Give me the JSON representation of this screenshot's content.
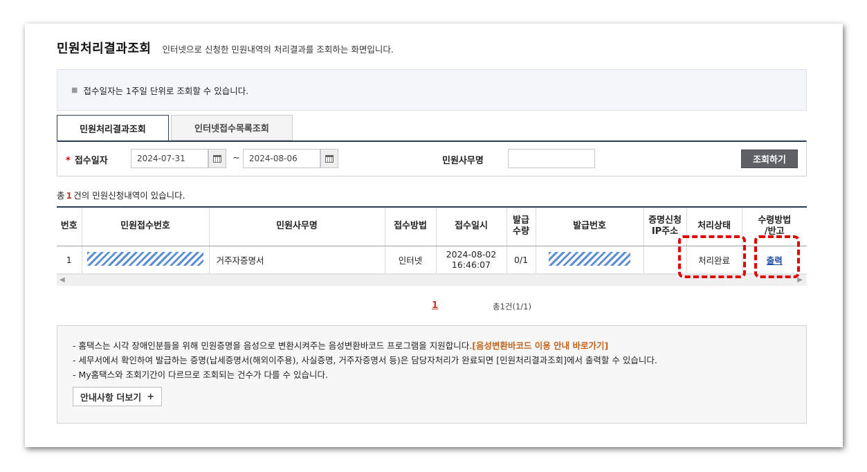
{
  "header": {
    "title": "민원처리결과조회",
    "description": "인터넷으로 신청한 민원내역의 처리결과를 조회하는 화면입니다."
  },
  "notice": {
    "text": "접수일자는 1주일 단위로 조회할 수 있습니다."
  },
  "tabs": [
    {
      "label": "민원처리결과조회",
      "active": true
    },
    {
      "label": "인터넷접수목록조회",
      "active": false
    }
  ],
  "search": {
    "date_label": "접수일자",
    "required_mark": "*",
    "start_date": "2024-07-31",
    "separator": "~",
    "end_date": "2024-08-06",
    "office_label": "민원사무명",
    "office_value": "",
    "button_label": "조회하기"
  },
  "result_count": {
    "prefix": "총",
    "count": "1",
    "suffix": "건의 민원신청내역이 있습니다."
  },
  "table": {
    "headers": [
      "번호",
      "민원접수번호",
      "민원사무명",
      "접수방법",
      "접수일시",
      "발급\n수량",
      "발급번호",
      "증명신청\nIP주소",
      "처리상태",
      "수령방법\n/반고"
    ],
    "rows": [
      {
        "no": "1",
        "receipt_no": "",
        "office_name": "거주자증명서",
        "method": "인터넷",
        "datetime_date": "2024-08-02",
        "datetime_time": "16:46:07",
        "issue_qty": "0/1",
        "issue_no": "",
        "ip": "",
        "status": "처리완료",
        "receive": "출력"
      }
    ]
  },
  "pager": {
    "current": "1",
    "total_text": "총1건(1/1)"
  },
  "info": {
    "lines": [
      {
        "text": "- 홈택스는 시각 장애인분들을 위해 민원증명을 음성으로 변환시켜주는 음성변환바코드 프로그램을 지원합니다.",
        "highlight": "[음성변환바코드 이용 안내 바로가기]"
      },
      {
        "text": "- 세무서에서 확인하여 발급하는 증명(납세증명서(해외이주용), 사실증명, 거주자증명서 등)은 담당자처리가 완료되면 [민원처리결과조회]에서 출력할 수 있습니다.",
        "highlight": ""
      },
      {
        "text": "- My홈택스와 조회기간이 다르므로 조회되는 건수가 다를 수 있습니다.",
        "highlight": ""
      }
    ],
    "more_label": "안내사항 더보기",
    "more_icon": "+"
  },
  "colors": {
    "accent_navy": "#2b3b55",
    "highlight_red": "#e00000",
    "link_blue": "#1a4aa5",
    "orange": "#c0641b"
  }
}
